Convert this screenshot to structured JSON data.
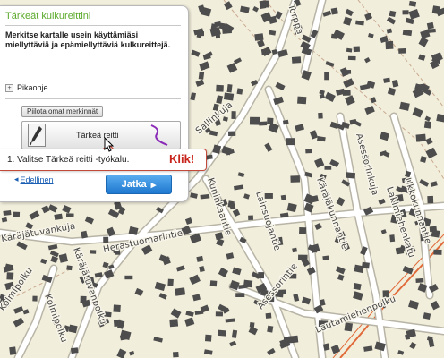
{
  "panel": {
    "title": "Tärkeät kulkureittini",
    "description": "Merkitse kartalle usein käyttämiäsi miellyttäviä ja epämiellyttäviä kulkureittejä.",
    "help_label": "Pikaohje",
    "help_toggle": "+",
    "hide_button": "Piilota omat merkinnät",
    "tool_button": "Tärkeä reitti",
    "back_link": "Edellinen",
    "next_button": "Jatka"
  },
  "tooltip": {
    "text": "1. Valitse Tärkeä reitti -työkalu.",
    "emphasis": "Klik!"
  },
  "map": {
    "streets": [
      "Torppa",
      "Sallinkuja",
      "Käräjätuvankuja",
      "Käräjätuvanpolku",
      "Herastuomarintie",
      "Kolmipolku",
      "Kolmipolku",
      "Käräjäkunnantie",
      "Kihlakunnantie",
      "Asessorinkuja",
      "Lautamiehenpolku",
      "Asessorintie",
      "Kuninkaantie",
      "Lainsuojantie",
      "Lakimiehenkatu",
      "Ukkokunnantie"
    ],
    "colors": {
      "background": "#f2eedc",
      "road": "#ffffff",
      "building": "#4d4d4d",
      "water_line": "#e06a3a"
    }
  },
  "colors": {
    "accent": "#5aa92a",
    "link": "#1a5fb4",
    "button": "#1f78cf",
    "alert": "#c8241b"
  }
}
